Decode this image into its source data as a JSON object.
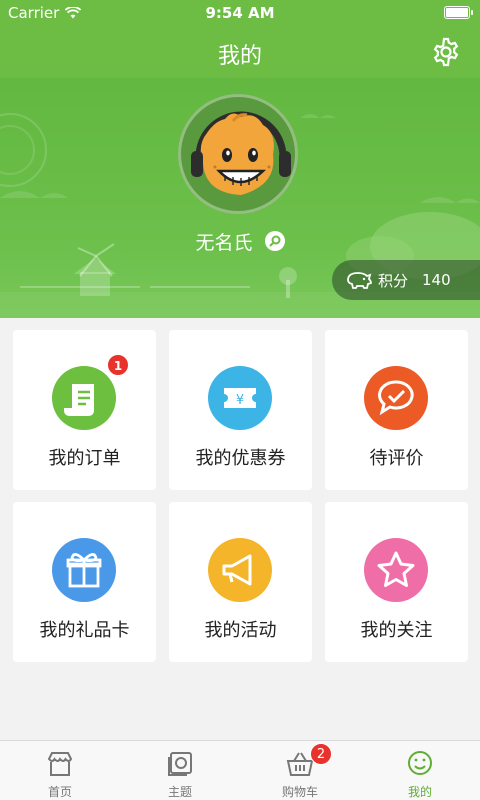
{
  "status": {
    "carrier": "Carrier",
    "time": "9:54 AM"
  },
  "nav": {
    "title": "我的",
    "settings_icon": "gear-icon"
  },
  "profile": {
    "username": "无名氏",
    "points_label": "积分",
    "points_value": "140"
  },
  "grid": [
    {
      "label": "我的订单",
      "icon": "receipt-icon",
      "color": "#6cbf3f",
      "badge": "1"
    },
    {
      "label": "我的优惠券",
      "icon": "coupon-icon",
      "color": "#3cb4e5"
    },
    {
      "label": "待评价",
      "icon": "comment-check-icon",
      "color": "#ec5a26"
    },
    {
      "label": "我的礼品卡",
      "icon": "gift-icon",
      "color": "#4a98e8"
    },
    {
      "label": "我的活动",
      "icon": "megaphone-icon",
      "color": "#f5b52b"
    },
    {
      "label": "我的关注",
      "icon": "star-icon",
      "color": "#f06ea8"
    }
  ],
  "tabs": [
    {
      "label": "首页",
      "icon": "storefront-icon"
    },
    {
      "label": "主题",
      "icon": "theme-icon"
    },
    {
      "label": "购物车",
      "icon": "basket-icon",
      "badge": "2"
    },
    {
      "label": "我的",
      "icon": "smiley-icon",
      "active": true
    }
  ],
  "colors": {
    "brand_green": "#6dbd45",
    "active_tab": "#5dae33",
    "badge_red": "#e8322c"
  }
}
